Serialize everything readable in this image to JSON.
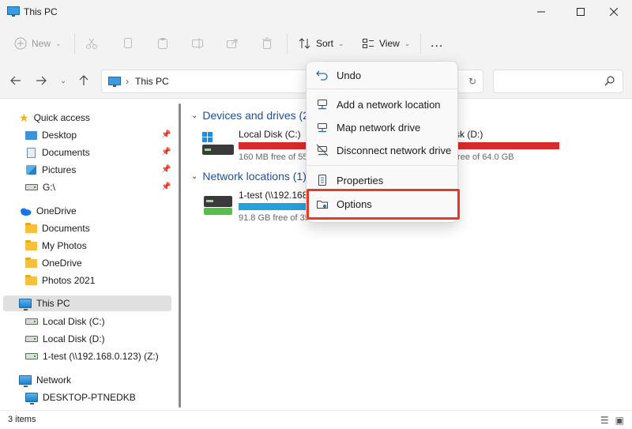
{
  "window": {
    "title": "This PC",
    "controls": [
      "minimize",
      "maximize",
      "close"
    ]
  },
  "toolbar": {
    "new_label": "New",
    "sort_label": "Sort",
    "view_label": "View",
    "more_label": "..."
  },
  "address": {
    "crumb": "This PC",
    "search_placeholder": ""
  },
  "nav": {
    "quick_access": "Quick access",
    "quick_items": [
      "Desktop",
      "Documents",
      "Pictures",
      "G:\\"
    ],
    "onedrive": "OneDrive",
    "onedrive_items": [
      "Documents",
      "My Photos",
      "OneDrive",
      "Photos 2021"
    ],
    "this_pc": "This PC",
    "pc_items": [
      "Local Disk (C:)",
      "Local Disk (D:)",
      "1-test (\\\\192.168.0.123) (Z:)"
    ],
    "network": "Network",
    "network_items": [
      "DESKTOP-PTNEDKB"
    ]
  },
  "main": {
    "devices_header": "Devices and drives (2)",
    "network_header": "Network locations (1)",
    "drives": [
      {
        "name": "Local Disk (C:)",
        "free": "160 MB free of 55",
        "used_fraction": 0.99,
        "color": "#d92b2b"
      },
      {
        "name": "sk (D:)",
        "free": "free of 64.0 GB",
        "used_fraction": 0.99,
        "color": "#d92b2b"
      }
    ],
    "network_drive": {
      "name": "1-test (\\\\192.168.0",
      "free": "91.8 GB free of 35",
      "used_fraction": 0.72,
      "color": "#26a0da"
    }
  },
  "menu": {
    "items": [
      "Undo",
      "Add a network location",
      "Map network drive",
      "Disconnect network drive",
      "Properties",
      "Options"
    ],
    "highlighted": "Options"
  },
  "status": {
    "count": "3 items"
  }
}
